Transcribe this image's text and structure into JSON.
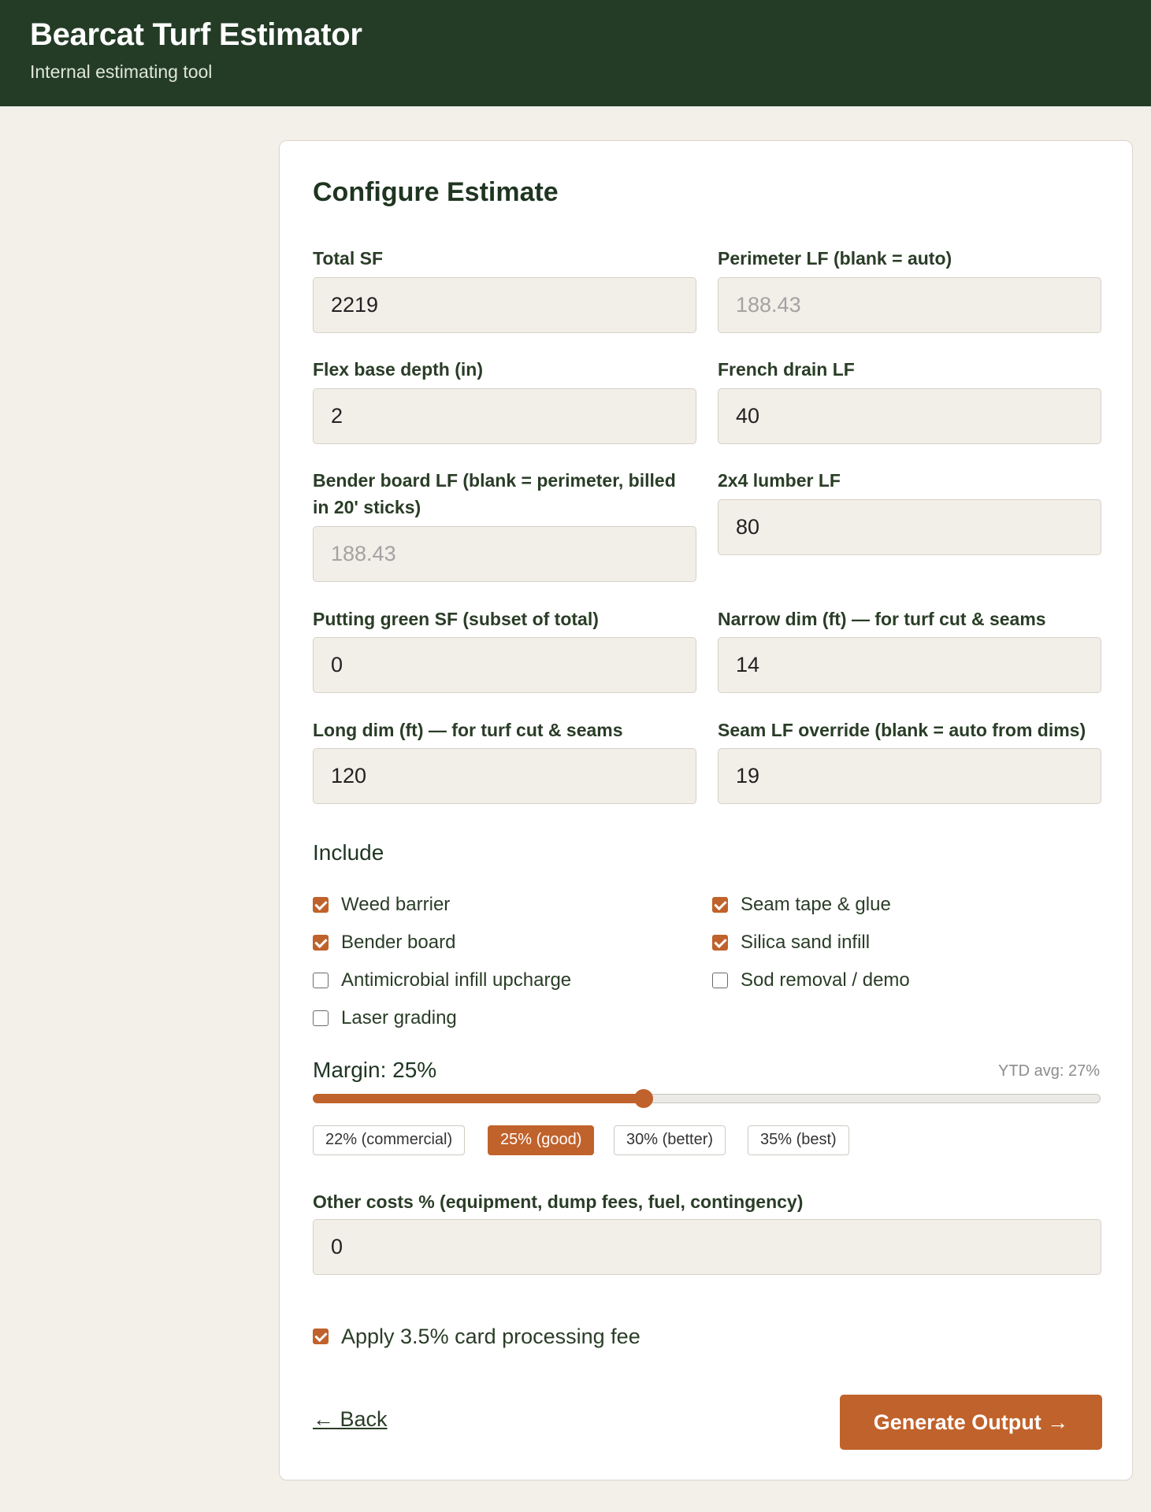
{
  "header": {
    "title": "Bearcat Turf Estimator",
    "subtitle": "Internal estimating tool"
  },
  "form": {
    "title": "Configure Estimate",
    "fields": {
      "total_sf": {
        "label": "Total SF",
        "value": "2219",
        "placeholder": ""
      },
      "perimeter_lf": {
        "label": "Perimeter LF (blank = auto)",
        "value": "",
        "placeholder": "188.43"
      },
      "flex_base_depth": {
        "label": "Flex base depth (in)",
        "value": "2",
        "placeholder": ""
      },
      "french_drain_lf": {
        "label": "French drain LF",
        "value": "40",
        "placeholder": ""
      },
      "bender_board_lf": {
        "label": "Bender board LF (blank = perimeter, billed in 20' sticks)",
        "value": "",
        "placeholder": "188.43"
      },
      "lumber_2x4_lf": {
        "label": "2x4 lumber LF",
        "value": "80",
        "placeholder": ""
      },
      "putting_green_sf": {
        "label": "Putting green SF (subset of total)",
        "value": "0",
        "placeholder": ""
      },
      "narrow_dim": {
        "label": "Narrow dim (ft) — for turf cut & seams",
        "value": "14",
        "placeholder": ""
      },
      "long_dim": {
        "label": "Long dim (ft) — for turf cut & seams",
        "value": "120",
        "placeholder": ""
      },
      "seam_lf_override": {
        "label": "Seam LF override (blank = auto from dims)",
        "value": "19",
        "placeholder": ""
      }
    },
    "include": {
      "heading": "Include",
      "options": [
        {
          "label": "Weed barrier",
          "checked": true
        },
        {
          "label": "Seam tape & glue",
          "checked": true
        },
        {
          "label": "Bender board",
          "checked": true
        },
        {
          "label": "Silica sand infill",
          "checked": true
        },
        {
          "label": "Antimicrobial infill upcharge",
          "checked": false
        },
        {
          "label": "Sod removal / demo",
          "checked": false
        },
        {
          "label": "Laser grading",
          "checked": false
        }
      ]
    },
    "margin": {
      "label": "Margin: 25%",
      "value_percent": 25,
      "slider_fraction": 0.42,
      "ytd_avg": "YTD avg: 27%",
      "presets": [
        {
          "label": "22% (commercial)",
          "active": false
        },
        {
          "label": "25% (good)",
          "active": true
        },
        {
          "label": "30% (better)",
          "active": false
        },
        {
          "label": "35% (best)",
          "active": false
        }
      ]
    },
    "other_costs": {
      "label": "Other costs % (equipment, dump fees, fuel, contingency)",
      "value": "0",
      "placeholder": ""
    },
    "card_fee": {
      "label": "Apply 3.5% card processing fee",
      "checked": true
    },
    "back_label": "← Back",
    "generate_label": "Generate Output →"
  },
  "colors": {
    "header_bg": "#243c26",
    "accent": "#c0622b",
    "page_bg": "#f3efe9"
  }
}
